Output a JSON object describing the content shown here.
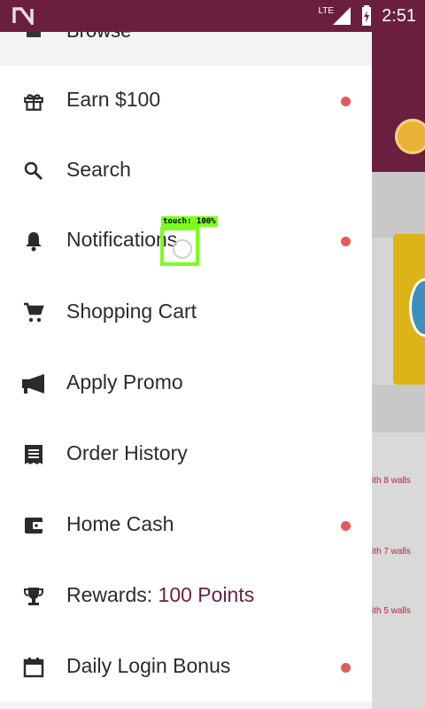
{
  "status_bar": {
    "time": "2:51",
    "network": "LTE"
  },
  "drawer": {
    "partial_item": "Browse",
    "items": [
      {
        "label": "Earn $100",
        "icon": "gift-icon",
        "dot": true
      },
      {
        "label": "Search",
        "icon": "search-icon",
        "dot": false
      },
      {
        "label": "Notifications",
        "icon": "bell-icon",
        "dot": true
      },
      {
        "label": "Shopping Cart",
        "icon": "cart-icon",
        "dot": false
      },
      {
        "label": "Apply Promo",
        "icon": "megaphone-icon",
        "dot": false
      },
      {
        "label": "Order History",
        "icon": "receipt-icon",
        "dot": false
      },
      {
        "label": "Home Cash",
        "icon": "wallet-icon",
        "dot": true
      },
      {
        "label": "Rewards: ",
        "points": "100 Points",
        "icon": "trophy-icon",
        "dot": false
      },
      {
        "label": "Daily Login Bonus",
        "icon": "calendar-icon",
        "dot": true
      }
    ]
  },
  "background": {
    "walls": [
      "ith 8 walls",
      "ith 7 walls",
      "ith 5 walls"
    ]
  },
  "overlay": {
    "touch_label": "touch: 100%"
  },
  "colors": {
    "brand": "#6b1f3f",
    "badge": "#e25b5b",
    "touch": "#7cff1f"
  }
}
